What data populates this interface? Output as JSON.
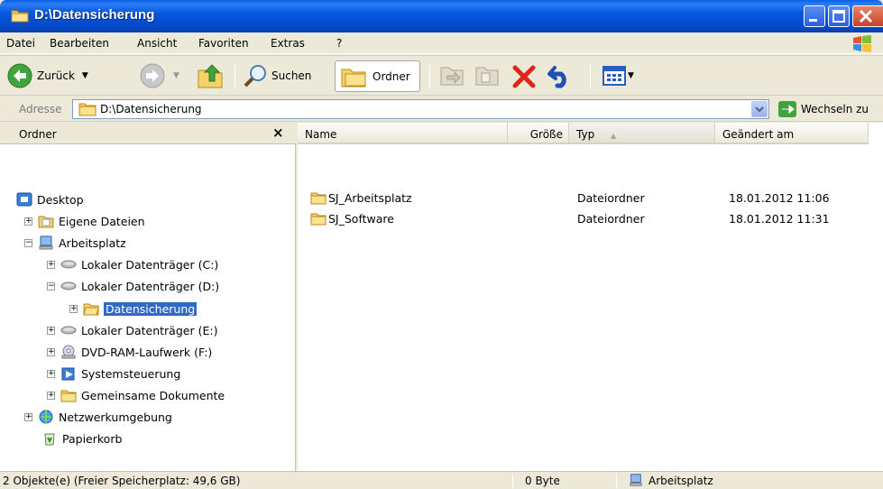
{
  "window": {
    "title": "D:\\Datensicherung"
  },
  "menu": [
    "Datei",
    "Bearbeiten",
    "Ansicht",
    "Favoriten",
    "Extras",
    "?"
  ],
  "toolbar": {
    "back_label": "Zurück",
    "search_label": "Suchen",
    "folders_label": "Ordner"
  },
  "address": {
    "label": "Adresse",
    "value": "D:\\Datensicherung",
    "go_label": "Wechseln zu"
  },
  "folder_pane": {
    "title": "Ordner",
    "close": "×",
    "tree": [
      {
        "label": "Desktop",
        "icon": "desktop-icon"
      },
      {
        "label": "Eigene Dateien",
        "icon": "my-documents-icon"
      },
      {
        "label": "Arbeitsplatz",
        "icon": "my-computer-icon"
      },
      {
        "label": "Lokaler Datenträger (C:)",
        "icon": "drive-icon"
      },
      {
        "label": "Lokaler Datenträger (D:)",
        "icon": "drive-icon"
      },
      {
        "label": "Datensicherung",
        "icon": "folder-icon",
        "selected": true
      },
      {
        "label": "Lokaler Datenträger (E:)",
        "icon": "drive-icon"
      },
      {
        "label": "DVD-RAM-Laufwerk (F:)",
        "icon": "dvd-drive-icon"
      },
      {
        "label": "Systemsteuerung",
        "icon": "control-panel-icon"
      },
      {
        "label": "Gemeinsame Dokumente",
        "icon": "folder-icon"
      },
      {
        "label": "Netzwerkumgebung",
        "icon": "network-icon"
      },
      {
        "label": "Papierkorb",
        "icon": "recycle-bin-icon"
      }
    ]
  },
  "list": {
    "columns": [
      "Name",
      "Größe",
      "Typ",
      "Geändert am"
    ],
    "sort_indicator": "▲",
    "rows": [
      {
        "name": "SJ_Arbeitsplatz",
        "size": "",
        "type": "Dateiordner",
        "modified": "18.01.2012 11:06"
      },
      {
        "name": "SJ_Software",
        "size": "",
        "type": "Dateiordner",
        "modified": "18.01.2012 11:31"
      }
    ]
  },
  "status": {
    "objects": "2 Objekte(e) (Freier Speicherplatz: 49,6 GB)",
    "size": "0 Byte",
    "location": "Arbeitsplatz"
  },
  "colors": {
    "titlebar": "#0a5fe4",
    "selection": "#316ac5",
    "chrome": "#ece9d8"
  }
}
